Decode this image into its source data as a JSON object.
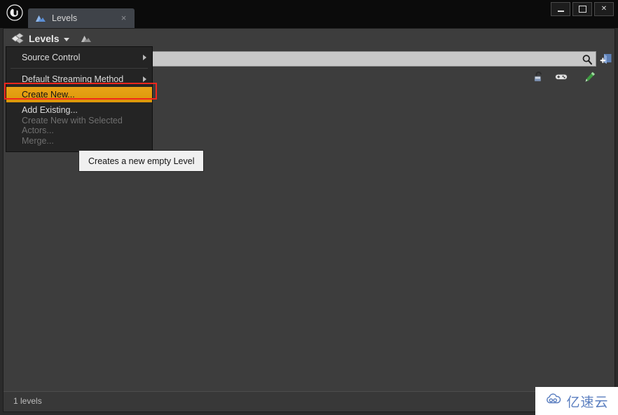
{
  "window": {
    "logo": "unreal-engine-logo",
    "controls": {
      "minimize": "minimize-button",
      "maximize": "maximize-button",
      "close_label": "✕"
    }
  },
  "tab": {
    "label": "Levels",
    "icon": "levels-mountain-icon",
    "close_label": "×"
  },
  "toolbar": {
    "levels_button_label": "Levels",
    "levels_icon": "cube-stack-icon",
    "dropdown_caret": "chevron-down-icon",
    "secondary_icon": "levels-mountain-icon"
  },
  "search": {
    "value": "",
    "placeholder": "",
    "magnifier_icon": "search-icon",
    "add_level_icon": "add-level-icon"
  },
  "column_icons": [
    {
      "name": "lock-icon"
    },
    {
      "name": "gamepad-icon"
    },
    {
      "name": "pencil-icon"
    }
  ],
  "menu": {
    "items": [
      {
        "label": "Source Control",
        "submenu": true,
        "disabled": false,
        "highlighted": false
      },
      {
        "separator": true
      },
      {
        "label": "Default Streaming Method",
        "submenu": true,
        "disabled": false,
        "highlighted": false
      },
      {
        "label": "Create New...",
        "submenu": false,
        "disabled": false,
        "highlighted": true
      },
      {
        "label": "Add Existing...",
        "submenu": false,
        "disabled": false,
        "highlighted": false
      },
      {
        "label": "Create New with Selected Actors...",
        "submenu": false,
        "disabled": true,
        "highlighted": false
      },
      {
        "label": "Merge...",
        "submenu": false,
        "disabled": true,
        "highlighted": false
      }
    ]
  },
  "tooltip": {
    "text": "Creates a new empty Level"
  },
  "status": {
    "text": "1 levels"
  },
  "watermark": {
    "text": "亿速云",
    "icon": "cloud-icon"
  },
  "colors": {
    "accent_highlight": "#e8a317",
    "annotation": "#f2271c",
    "panel_bg": "#3d3d3d",
    "menu_bg": "#242424",
    "search_bg": "#c8c8c8",
    "watermark_text": "#5b7fc0"
  }
}
